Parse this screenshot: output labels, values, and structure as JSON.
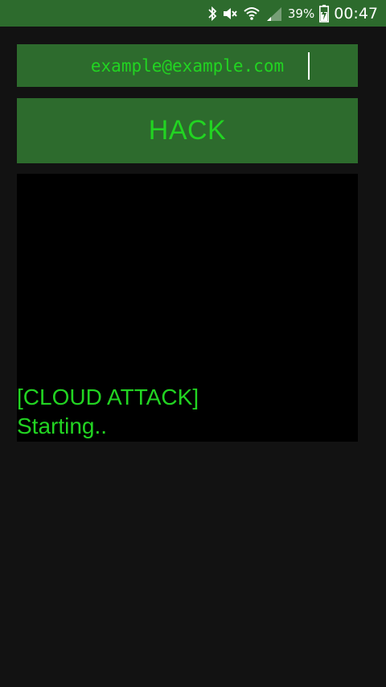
{
  "status_bar": {
    "icons": [
      "bluetooth-icon",
      "mute-icon",
      "wifi-icon",
      "signal-icon",
      "battery-charging-icon"
    ],
    "battery_percent": "39%",
    "time": "00:47"
  },
  "email_input": {
    "value": "example@example.com"
  },
  "hack_button": {
    "label": "HACK"
  },
  "console": {
    "lines": [
      "[CLOUD ATTACK]",
      "Starting.."
    ]
  },
  "colors": {
    "background": "#121212",
    "panel_green": "#2d6b2d",
    "text_green": "#22d422",
    "console_bg": "#000000"
  }
}
